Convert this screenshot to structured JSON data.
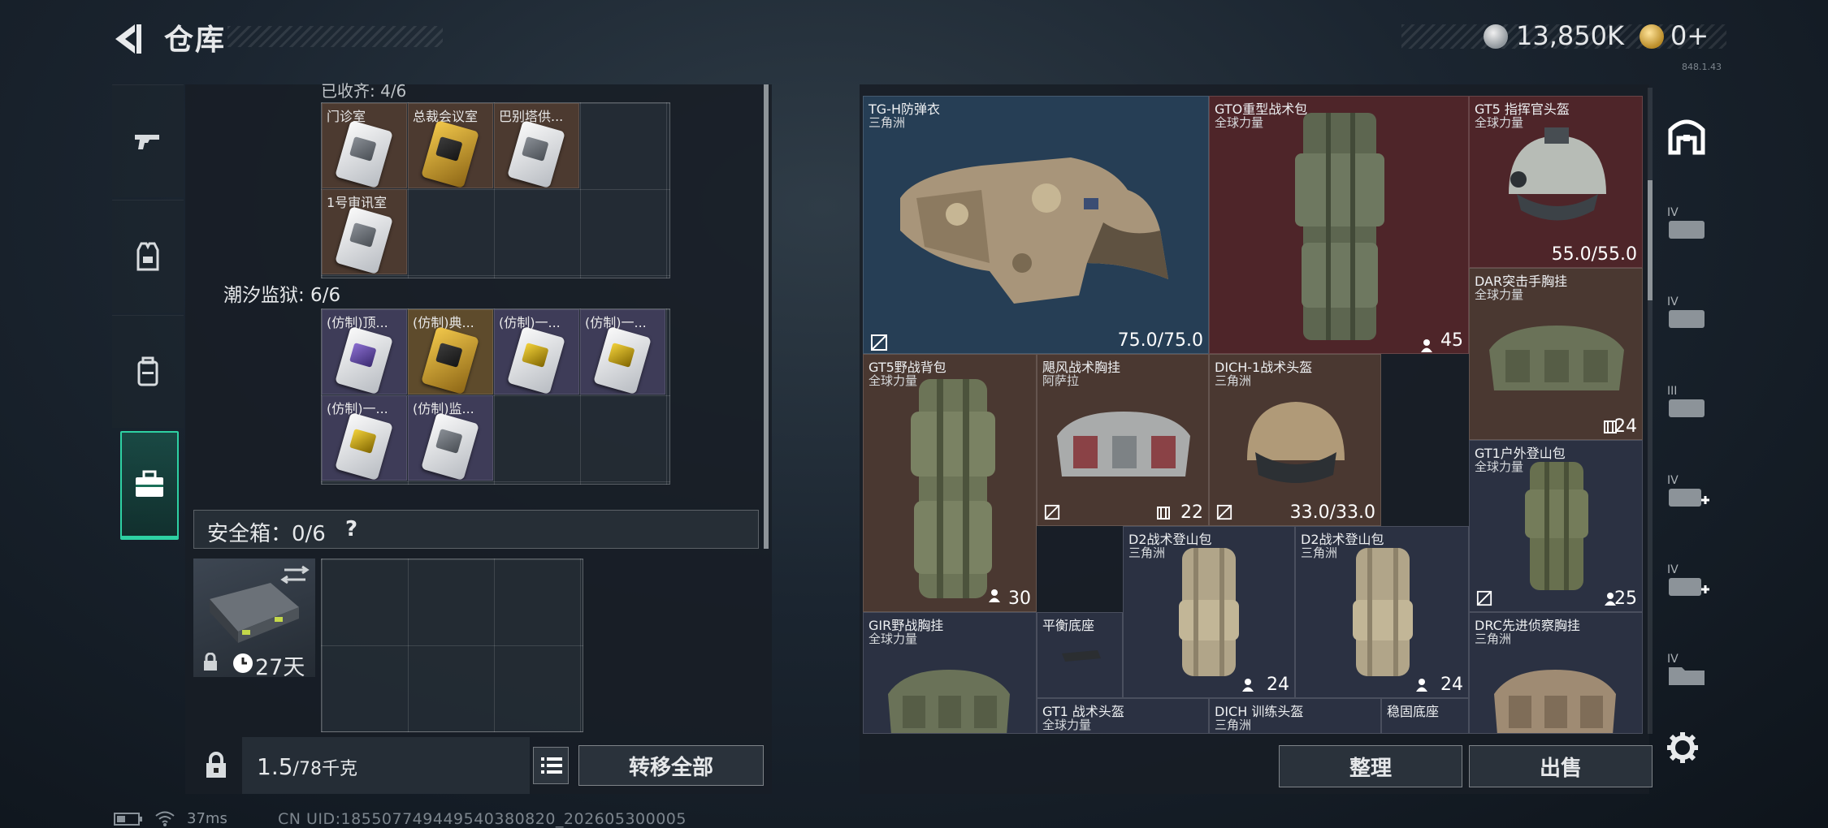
{
  "header": {
    "title": "仓库"
  },
  "currency": {
    "coins": "13,850K",
    "premium": "0+"
  },
  "version": "848.1.43",
  "left_nav": {
    "items": [
      "weapon",
      "equipment",
      "backpack",
      "warehouse"
    ],
    "active": "warehouse"
  },
  "collection": {
    "section_a_label": "已收齐: 4/6",
    "section_a_items": [
      {
        "name": "门诊室",
        "style": "brown",
        "card": "silver"
      },
      {
        "name": "总裁会议室",
        "style": "brown",
        "card": "gold"
      },
      {
        "name": "巴别塔供...",
        "style": "brown",
        "card": "silver"
      },
      {
        "name": "1号审讯室",
        "style": "brown",
        "card": "silver"
      }
    ],
    "section_b_label": "潮汐监狱: 6/6",
    "section_b_items": [
      {
        "name": "(仿制)顶...",
        "style": "purple",
        "card": "purple"
      },
      {
        "name": "(仿制)典...",
        "style": "gold",
        "card": "gold"
      },
      {
        "name": "(仿制)一...",
        "style": "purple",
        "card": "yellow"
      },
      {
        "name": "(仿制)一...",
        "style": "purple",
        "card": "yellow"
      },
      {
        "name": "(仿制)一...",
        "style": "purple",
        "card": "yellow"
      },
      {
        "name": "(仿制)监...",
        "style": "purple",
        "card": "silver"
      }
    ]
  },
  "safe_box": {
    "label": "安全箱：0/6",
    "help": "?",
    "time_left": "27天"
  },
  "weight": {
    "current": "1.5",
    "max": "/78千克"
  },
  "buttons": {
    "move_all": "转移全部",
    "organize": "整理",
    "sell": "出售"
  },
  "stash_items": [
    {
      "name": "TG-H防弹衣",
      "sub": "三角洲",
      "durability": "75.0/75.0"
    },
    {
      "name": "GTO重型战术包",
      "sub": "全球力量",
      "count": "45"
    },
    {
      "name": "GT5 指挥官头盔",
      "sub": "全球力量",
      "durability": "55.0/55.0"
    },
    {
      "name": "DAR突击手胸挂",
      "sub": "全球力量",
      "count": "24"
    },
    {
      "name": "GT5野战背包",
      "sub": "全球力量",
      "count": "30"
    },
    {
      "name": "飓风战术胸挂",
      "sub": "阿萨拉",
      "count": "22"
    },
    {
      "name": "DICH-1战术头盔",
      "sub": "三角洲",
      "durability": "33.0/33.0"
    },
    {
      "name": "GT1户外登山包",
      "sub": "全球力量",
      "count": "25"
    },
    {
      "name": "D2战术登山包",
      "sub": "三角洲",
      "count": "24"
    },
    {
      "name": "D2战术登山包",
      "sub": "三角洲",
      "count": "24"
    },
    {
      "name": "GIR野战胸挂",
      "sub": "全球力量"
    },
    {
      "name": "平衡底座",
      "sub": ""
    },
    {
      "name": "DRC先进侦察胸挂",
      "sub": "三角洲"
    },
    {
      "name": "GT1 战术头盔",
      "sub": "全球力量"
    },
    {
      "name": "DICH 训练头盔",
      "sub": "三角洲"
    },
    {
      "name": "稳固底座",
      "sub": ""
    }
  ],
  "status_bar": {
    "ping": "37ms",
    "uid": "CN UID:185507749449540380820_202605300005"
  },
  "colors": {
    "accent": "#2ed1a3",
    "blue_cell": "#263e55",
    "red_cell": "#4e2529",
    "brown_cell": "#4a3831",
    "purple_cell": "#2b3142"
  }
}
